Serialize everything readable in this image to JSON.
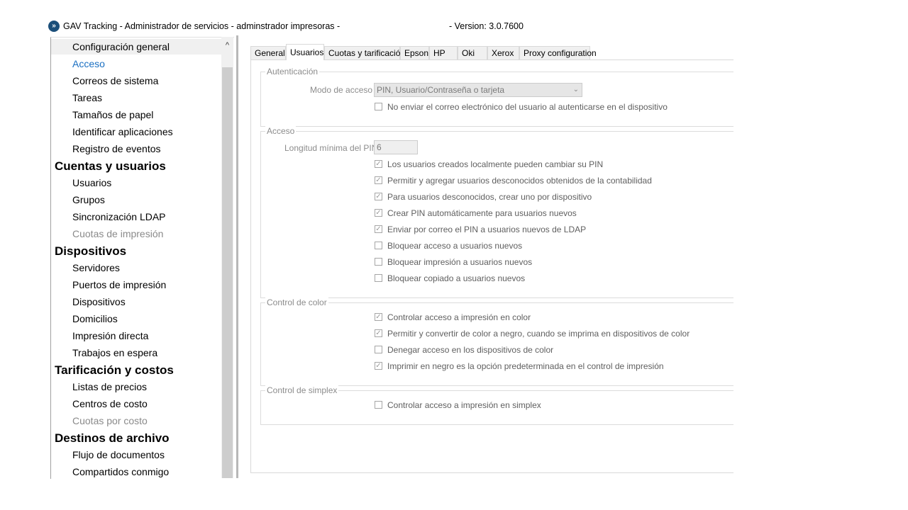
{
  "window": {
    "title": "GAV Tracking - Administrador de servicios - adminstrador impresoras -",
    "version": "- Version: 3.0.7600",
    "icon": "app-logo-icon"
  },
  "sidebar": {
    "items": [
      {
        "label": "Configuración general",
        "kind": "item",
        "state": "highlighted"
      },
      {
        "label": "Acceso",
        "kind": "item",
        "state": "selected"
      },
      {
        "label": "Correos de sistema",
        "kind": "item"
      },
      {
        "label": "Tareas",
        "kind": "item"
      },
      {
        "label": "Tamaños de papel",
        "kind": "item"
      },
      {
        "label": "Identificar aplicaciones",
        "kind": "item"
      },
      {
        "label": "Registro de eventos",
        "kind": "item"
      },
      {
        "label": "Cuentas y usuarios",
        "kind": "group"
      },
      {
        "label": "Usuarios",
        "kind": "item"
      },
      {
        "label": "Grupos",
        "kind": "item"
      },
      {
        "label": "Sincronización LDAP",
        "kind": "item"
      },
      {
        "label": "Cuotas de impresión",
        "kind": "item",
        "state": "disabled"
      },
      {
        "label": "Dispositivos",
        "kind": "group"
      },
      {
        "label": "Servidores",
        "kind": "item"
      },
      {
        "label": "Puertos de impresión",
        "kind": "item"
      },
      {
        "label": "Dispositivos",
        "kind": "item"
      },
      {
        "label": "Domicilios",
        "kind": "item"
      },
      {
        "label": "Impresión directa",
        "kind": "item"
      },
      {
        "label": "Trabajos en espera",
        "kind": "item"
      },
      {
        "label": "Tarificación y costos",
        "kind": "group"
      },
      {
        "label": "Listas de precios",
        "kind": "item"
      },
      {
        "label": "Centros de costo",
        "kind": "item"
      },
      {
        "label": "Cuotas por costo",
        "kind": "item",
        "state": "disabled"
      },
      {
        "label": "Destinos de archivo",
        "kind": "group"
      },
      {
        "label": "Flujo de documentos",
        "kind": "item"
      },
      {
        "label": "Compartidos conmigo",
        "kind": "item"
      }
    ],
    "scroll_up_glyph": "^"
  },
  "tabs": [
    {
      "label": "General"
    },
    {
      "label": "Usuarios",
      "active": true
    },
    {
      "label": "Cuotas y tarificación"
    },
    {
      "label": "Epson"
    },
    {
      "label": "HP"
    },
    {
      "label": "Oki"
    },
    {
      "label": "Xerox"
    },
    {
      "label": "Proxy configuration"
    }
  ],
  "autenticacion": {
    "title": "Autenticación",
    "mode_label": "Modo de acceso",
    "mode_value": "PIN, Usuario/Contraseña o tarjeta",
    "options": [
      {
        "label": "No enviar el correo electrónico del usuario al autenticarse en el dispositivo",
        "checked": false
      }
    ]
  },
  "acceso": {
    "title": "Acceso",
    "pin_label": "Longitud mínima del PIN",
    "pin_value": "6",
    "options": [
      {
        "label": "Los usuarios creados localmente pueden cambiar su PIN",
        "checked": true
      },
      {
        "label": "Permitir y agregar usuarios desconocidos obtenidos de la contabilidad",
        "checked": true
      },
      {
        "label": "Para usuarios desconocidos, crear uno por dispositivo",
        "checked": true
      },
      {
        "label": "Crear PIN automáticamente para usuarios nuevos",
        "checked": true
      },
      {
        "label": "Enviar por correo el PIN a usuarios nuevos de LDAP",
        "checked": true
      },
      {
        "label": "Bloquear acceso a usuarios nuevos",
        "checked": false
      },
      {
        "label": "Bloquear impresión a usuarios nuevos",
        "checked": false
      },
      {
        "label": "Bloquear copiado a usuarios nuevos",
        "checked": false
      }
    ]
  },
  "control_color": {
    "title": "Control de color",
    "options": [
      {
        "label": "Controlar acceso a impresión en color",
        "checked": true
      },
      {
        "label": "Permitir y convertir de color a negro, cuando se imprima en dispositivos de color",
        "checked": true
      },
      {
        "label": "Denegar acceso en los dispositivos de color",
        "checked": false
      },
      {
        "label": "Imprimir en negro es la opción predeterminada en el control de impresión",
        "checked": true
      }
    ]
  },
  "control_simplex": {
    "title": "Control de simplex",
    "options": [
      {
        "label": "Controlar acceso a impresión en simplex",
        "checked": false
      }
    ]
  },
  "glyphs": {
    "check": "✓",
    "chevron": "⌄"
  }
}
